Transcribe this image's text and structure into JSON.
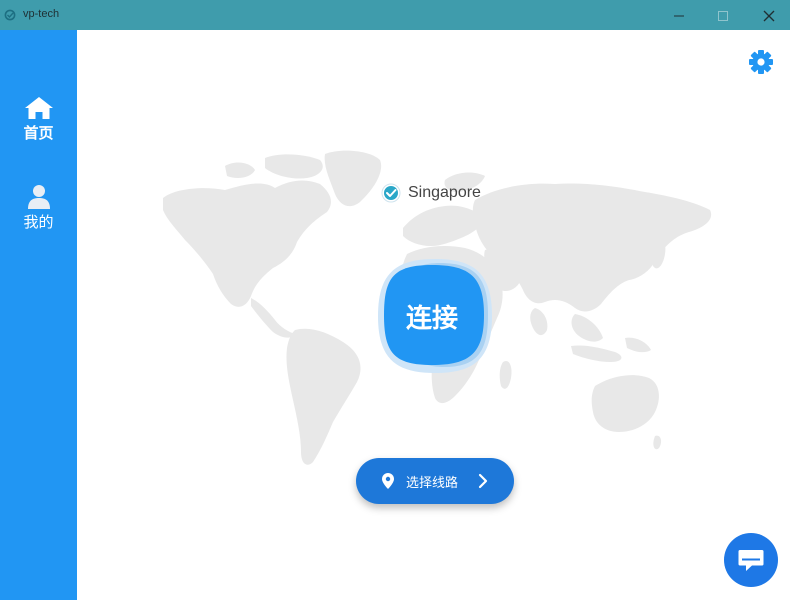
{
  "window": {
    "title": "vp-tech"
  },
  "sidebar": {
    "items": [
      {
        "label": "首页",
        "icon": "home-icon",
        "active": true
      },
      {
        "label": "我的",
        "icon": "user-icon",
        "active": false
      }
    ]
  },
  "main": {
    "location": {
      "name": "Singapore",
      "icon": "check-badge-icon"
    },
    "connect_label": "连接",
    "route_button_label": "选择线路"
  },
  "colors": {
    "titlebar": "#3f9cac",
    "sidebar": "#2196f3",
    "accent": "#1e78d9",
    "map": "#e8e8e8"
  }
}
